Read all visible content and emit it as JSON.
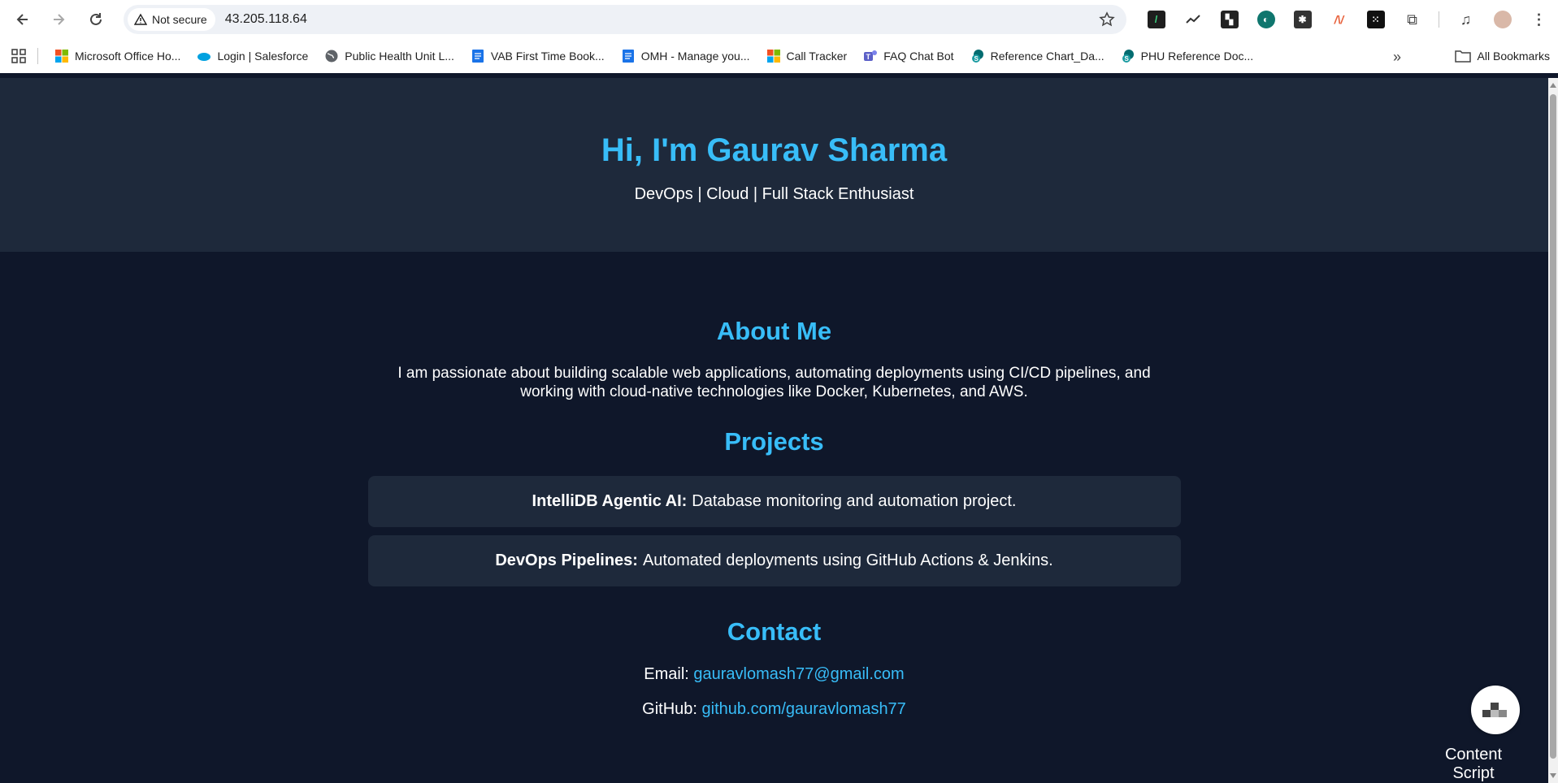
{
  "browser": {
    "security_label": "Not secure",
    "url": "43.205.118.64",
    "bookmarks": [
      {
        "label": "Microsoft Office Ho...",
        "icon": "microsoft-icon"
      },
      {
        "label": "Login | Salesforce",
        "icon": "salesforce-icon"
      },
      {
        "label": "Public Health Unit L...",
        "icon": "globe-icon"
      },
      {
        "label": "VAB First Time Book...",
        "icon": "doc-icon"
      },
      {
        "label": "OMH - Manage you...",
        "icon": "doc-icon"
      },
      {
        "label": "Call Tracker",
        "icon": "microsoft-icon"
      },
      {
        "label": "FAQ Chat Bot",
        "icon": "teams-icon"
      },
      {
        "label": "Reference Chart_Da...",
        "icon": "sharepoint-icon"
      },
      {
        "label": "PHU Reference Doc...",
        "icon": "sharepoint-icon"
      }
    ],
    "all_bookmarks_label": "All Bookmarks"
  },
  "hero": {
    "title": "Hi, I'm Gaurav Sharma",
    "tagline": "DevOps | Cloud | Full Stack Enthusiast"
  },
  "about": {
    "title": "About Me",
    "text": "I am passionate about building scalable web applications, automating deployments using CI/CD pipelines, and working with cloud-native technologies like Docker, Kubernetes, and AWS."
  },
  "projects": {
    "title": "Projects",
    "items": [
      {
        "name": "IntelliDB Agentic AI:",
        "description": "Database monitoring and automation project."
      },
      {
        "name": "DevOps Pipelines:",
        "description": "Automated deployments using GitHub Actions & Jenkins."
      }
    ]
  },
  "contact": {
    "title": "Contact",
    "email_label": "Email:",
    "email": "gauravlomash77@gmail.com",
    "github_label": "GitHub:",
    "github": "github.com/gauravlomash77"
  },
  "widget": {
    "label": "Content Script"
  },
  "colors": {
    "accent": "#38bdf8",
    "hero_bg": "#1e293b",
    "page_bg": "#0f172a"
  }
}
